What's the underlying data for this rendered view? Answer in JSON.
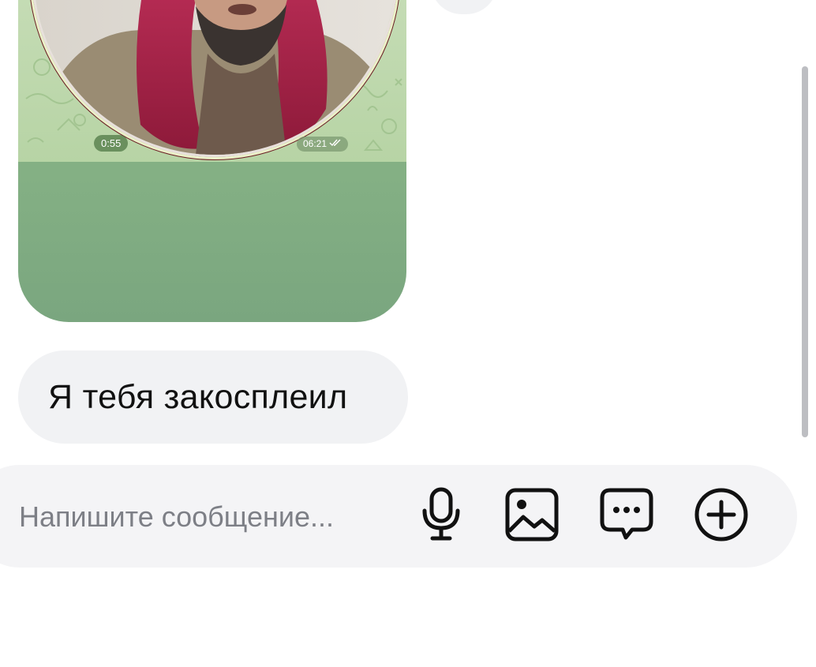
{
  "video_message": {
    "duration": "0:55",
    "time": "06:21",
    "status_icon": "double-check-icon"
  },
  "text_message": {
    "text": "Я тебя закосплеил"
  },
  "composer": {
    "placeholder": "Напишите сообщение...",
    "icons": [
      "microphone-icon",
      "image-icon",
      "chat-bubble-dots-icon",
      "plus-circle-icon"
    ]
  },
  "colors": {
    "bubble_bg": "#f1f2f4",
    "video_card_green": "#84b084",
    "wallpaper_green": "#bfd8ad",
    "composer_bg": "#f4f4f6",
    "placeholder_text": "#7d7f86"
  }
}
